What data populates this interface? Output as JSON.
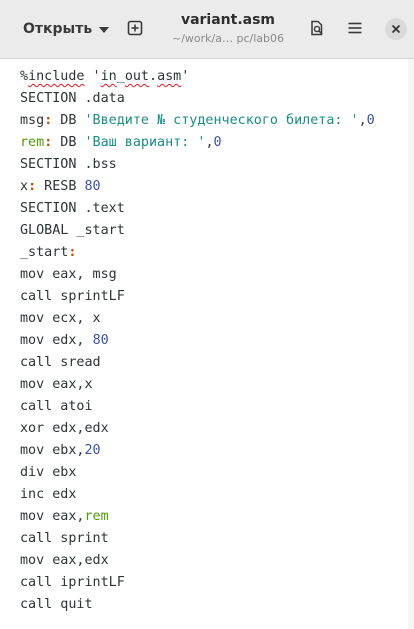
{
  "header": {
    "open_label": "Открыть",
    "title": "variant.asm",
    "subtitle": "~/work/a… pc/lab06"
  },
  "icons": {
    "open_menu": "chevron-down-icon",
    "new_tab": "new-tab-icon",
    "search": "find-icon",
    "menu": "hamburger-menu-icon",
    "close": "close-icon"
  },
  "colors": {
    "string": "#1a8c86",
    "number": "#3d52a6",
    "label_colon": "#c64600",
    "green_identifier": "#4e9a06",
    "spell_error": "#e01b24"
  },
  "code": {
    "l1": {
      "a": "%",
      "b": "include",
      "c": " '",
      "d": "in",
      "e": "_",
      "f": "out",
      "g": ".",
      "h": "asm",
      "i": "'"
    },
    "l2": "SECTION .data",
    "l3": {
      "label": "msg",
      "colon": ":",
      "mid": " DB ",
      "str": "'Введите № студенческого билета: '",
      "comma": ",",
      "num": "0"
    },
    "l4": {
      "label": "rem",
      "colon": ":",
      "mid": " DB ",
      "str": "'Ваш вариант: '",
      "comma": ",",
      "num": "0"
    },
    "l5": "SECTION .bss",
    "l6": {
      "label": "x",
      "colon": ":",
      "mid": " RESB ",
      "num": "80"
    },
    "l7": "SECTION .text",
    "l8": "GLOBAL _start",
    "l9": {
      "label": "_start",
      "colon": ":"
    },
    "l10": "mov eax, msg",
    "l11": "call sprintLF",
    "l12": "mov ecx, x",
    "l13": {
      "pre": "mov edx, ",
      "num": "80"
    },
    "l14": "call sread",
    "l15": "mov eax,x",
    "l16": "call atoi",
    "l17": "xor edx,edx",
    "l18": {
      "pre": "mov ebx,",
      "num": "20"
    },
    "l19": "div ebx",
    "l20": "inc edx",
    "l21": {
      "pre": "mov eax,",
      "ident": "rem"
    },
    "l22": "call sprint",
    "l23": "mov eax,edx",
    "l24": "call iprintLF",
    "l25": "call quit"
  }
}
